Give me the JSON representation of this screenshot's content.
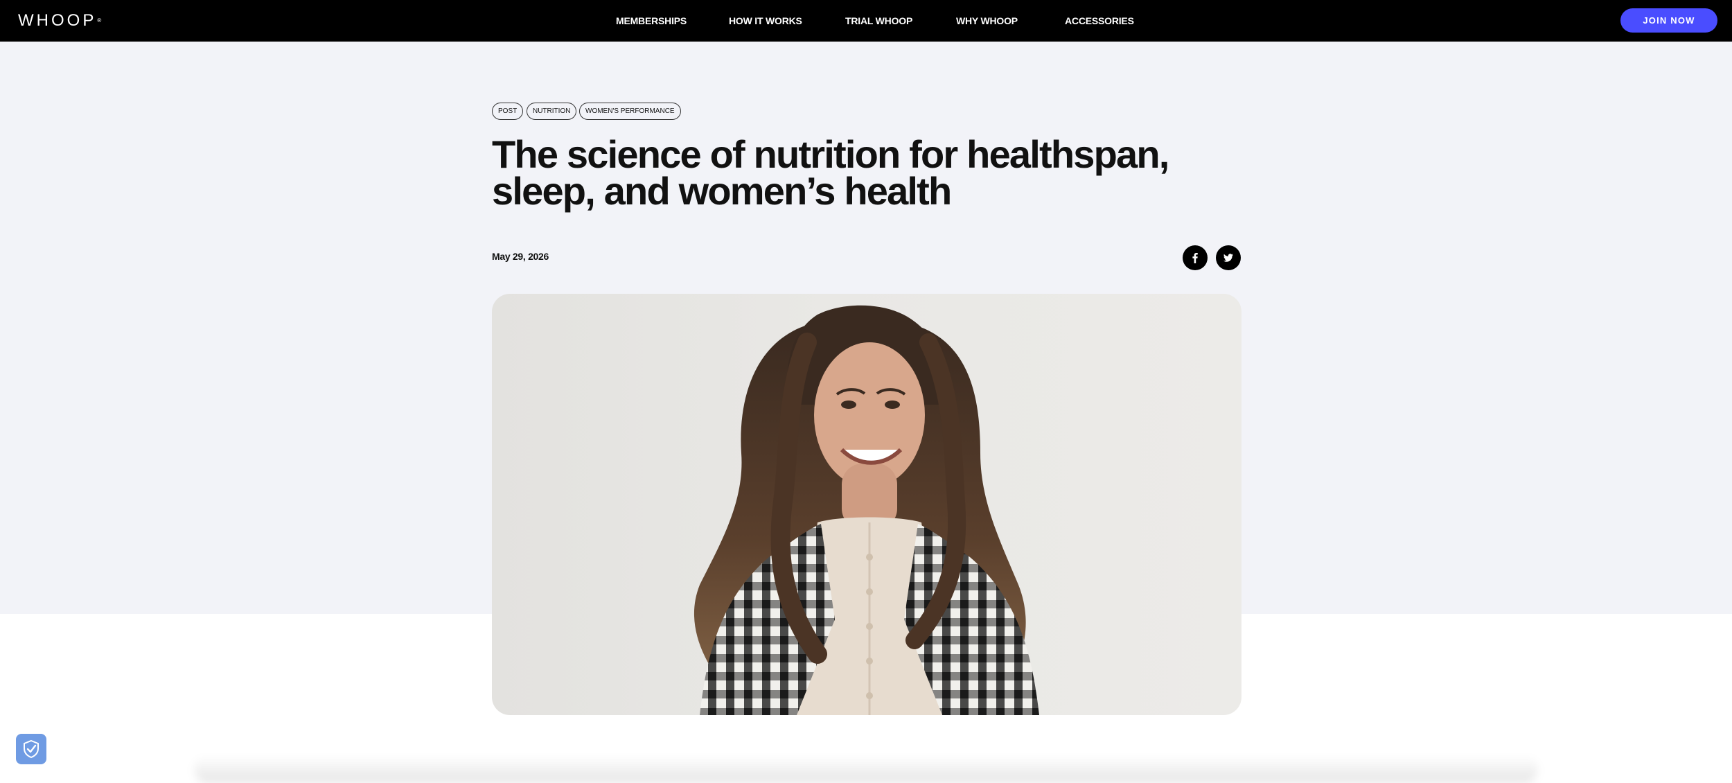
{
  "header": {
    "logo_text": "WHOOP",
    "logo_mark": "®",
    "nav": [
      {
        "label": "MEMBERSHIPS"
      },
      {
        "label": "HOW IT WORKS"
      },
      {
        "label": "TRIAL WHOOP"
      },
      {
        "label": "WHY WHOOP"
      },
      {
        "label": "ACCESSORIES"
      }
    ],
    "cta_label": "JOIN NOW",
    "cta_color": "#4a4dff"
  },
  "article": {
    "tags": [
      "POST",
      "NUTRITION",
      "WOMEN'S PERFORMANCE"
    ],
    "title": "The science of nutrition for healthspan, sleep, and women’s health",
    "date": "May 29, 2026",
    "share": [
      {
        "icon": "facebook-icon"
      },
      {
        "icon": "twitter-icon"
      }
    ],
    "hero_image": "portrait-woman-plaid-blazer"
  },
  "colors": {
    "header_bg": "#000000",
    "hero_bg": "#f2f3f8",
    "privacy_button": "#6f9be3"
  },
  "widgets": {
    "privacy_icon": "shield-check-icon"
  }
}
